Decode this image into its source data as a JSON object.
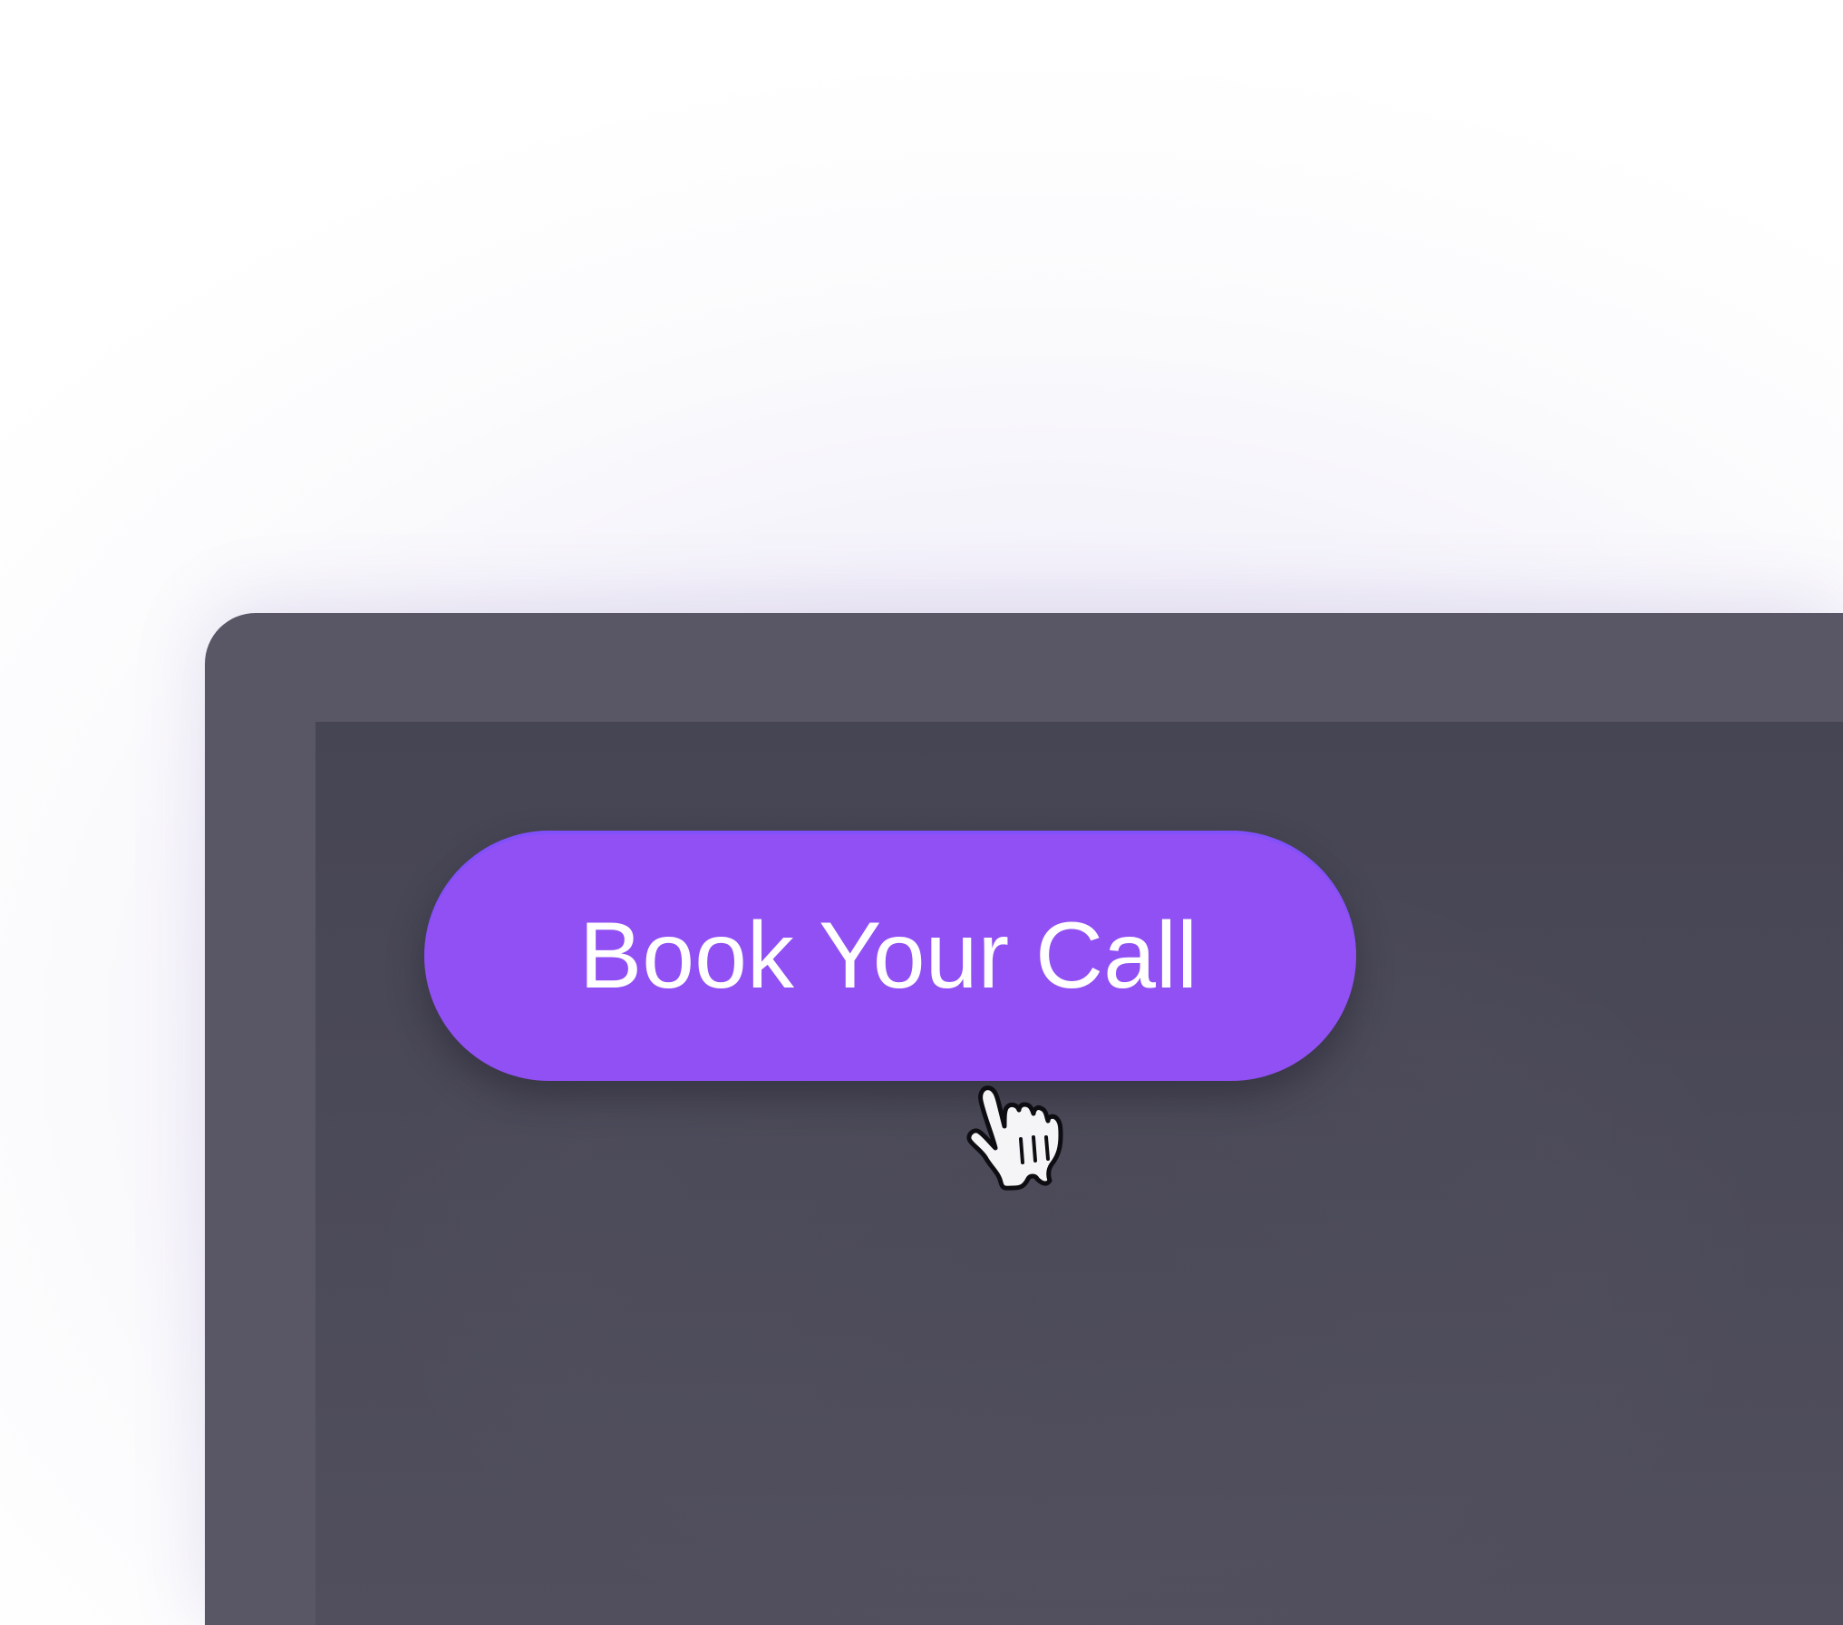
{
  "cta": {
    "label": "Book Your Call"
  },
  "cursor": {
    "icon": "hand-pointer-icon"
  },
  "colors": {
    "background": "#fbfbfd",
    "device_frame": "#595766",
    "screen": "#4b4a58",
    "button": "#9150f4",
    "button_text": "#ffffff"
  }
}
